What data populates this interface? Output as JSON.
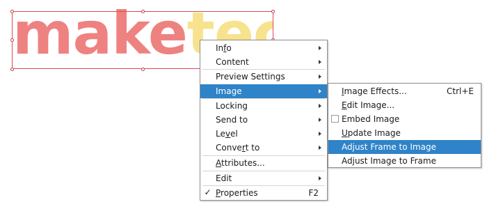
{
  "canvas": {
    "logo_text_primary": "make",
    "logo_text_secondary": "tec",
    "logo_colors": {
      "primary": "#ee8280",
      "secondary": "#f7e38d"
    },
    "frame_color": "#d74a5a"
  },
  "context_menu": {
    "highlight_color": "#2f83c8",
    "items": [
      {
        "label_pre": "In",
        "label_u": "f",
        "label_post": "o",
        "submenu": true
      },
      {
        "label_pre": "Content",
        "label_u": "",
        "label_post": "",
        "submenu": true
      },
      {
        "label_pre": "Preview Settings",
        "label_u": "",
        "label_post": "",
        "submenu": true
      },
      {
        "label_pre": "Image",
        "label_u": "",
        "label_post": "",
        "submenu": true,
        "highlighted": true
      },
      {
        "label_pre": "Locking",
        "label_u": "",
        "label_post": "",
        "submenu": true
      },
      {
        "label_pre": "Send to",
        "label_u": "",
        "label_post": "",
        "submenu": true
      },
      {
        "label_pre": "Le",
        "label_u": "v",
        "label_post": "el",
        "submenu": true
      },
      {
        "label_pre": "Conve",
        "label_u": "r",
        "label_post": "t to",
        "submenu": true
      },
      {
        "label_pre": "",
        "label_u": "A",
        "label_post": "ttributes...",
        "submenu": false
      },
      {
        "label_pre": "Edit",
        "label_u": "",
        "label_post": "",
        "submenu": true
      },
      {
        "label_pre": "",
        "label_u": "P",
        "label_post": "roperties",
        "submenu": false,
        "checked": true,
        "shortcut": "F2"
      }
    ]
  },
  "image_submenu": {
    "items": [
      {
        "label_pre": "",
        "label_u": "I",
        "label_post": "mage Effects...",
        "shortcut": "Ctrl+E"
      },
      {
        "label_pre": "",
        "label_u": "E",
        "label_post": "dit Image...",
        "shortcut": ""
      },
      {
        "label_pre": "Embed Image",
        "label_u": "",
        "label_post": "",
        "checkbox": true,
        "checked": false
      },
      {
        "label_pre": "",
        "label_u": "U",
        "label_post": "pdate Image",
        "shortcut": ""
      },
      {
        "label_pre": "Adjust Frame to Image",
        "label_u": "",
        "label_post": "",
        "highlighted": true
      },
      {
        "label_pre": "Adjust Image to Frame",
        "label_u": "",
        "label_post": ""
      }
    ]
  }
}
